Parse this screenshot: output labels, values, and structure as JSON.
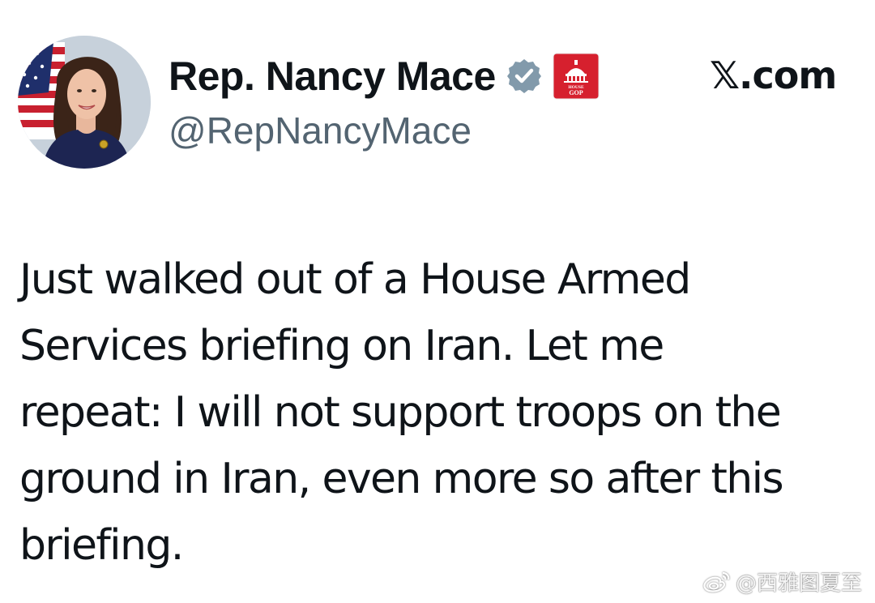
{
  "tweet": {
    "author": {
      "display_name": "Rep. Nancy Mace",
      "handle": "@RepNancyMace",
      "verified_icon": "verified-badge-icon",
      "affiliation_icon": "house-gop-badge-icon",
      "affiliation_label_top": "HOUSE",
      "affiliation_label_bottom": "GOP",
      "avatar": "profile-photo"
    },
    "source": "𝕏.com",
    "text": "Just walked out of a House Armed\nServices briefing on Iran. Let me\nrepeat: I will not support troops on the\nground in Iran, even more so after this\nbriefing."
  },
  "watermark": {
    "icon": "weibo-icon",
    "text": "@西雅图夏至"
  },
  "colors": {
    "background": "#ffffff",
    "text_primary": "#0f1419",
    "text_secondary": "#536471",
    "verified_badge": "#829aab",
    "gop_badge": "#d6202e"
  }
}
